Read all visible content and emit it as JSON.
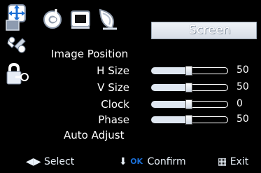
{
  "menu_title": "Screen",
  "tabs": [
    {
      "name": "image-position-tab",
      "icon": "move-arrows-icon"
    },
    {
      "name": "audio-tab",
      "icon": "music-note-icon"
    },
    {
      "name": "monitor-tab",
      "icon": "monitor-icon"
    },
    {
      "name": "color-tab",
      "icon": "satellite-dish-icon"
    }
  ],
  "side_icons": [
    "tools-icon",
    "lock-key-icon"
  ],
  "items": {
    "image_position": "Image Position",
    "h_size": {
      "label": "H Size",
      "value": "50",
      "level": 0.5
    },
    "v_size": {
      "label": "V Size",
      "value": "50",
      "level": 0.5
    },
    "clock": {
      "label": "Clock",
      "value": "0",
      "level": 0.5
    },
    "phase": {
      "label": "Phase",
      "value": "50",
      "level": 0.5
    },
    "auto_adjust": "Auto Adjust"
  },
  "footer": {
    "select": "Select",
    "ok": "OK",
    "confirm": "Confirm",
    "exit": "Exit"
  },
  "colors": {
    "accent": "#1b6fd6",
    "title_bg": "#e5eaf0",
    "text": "#ffffff"
  }
}
